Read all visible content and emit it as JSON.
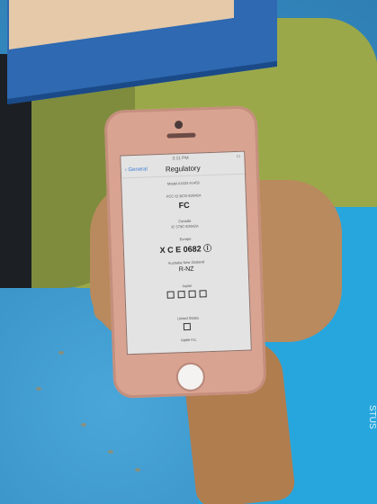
{
  "phone": {
    "status_left": "",
    "status_time": "3:11 PM",
    "back_label": "General",
    "screen_title": "Regulatory",
    "model_label": "Model A1533 A1453",
    "fcc_caption": "FCC ID BCG-E2642A",
    "fcc_mark": "FC",
    "canada_caption": "Canada",
    "canada_id": "IC 579C-E2642A",
    "europe_caption": "Europe",
    "europe_mark": "X C E 0682 ⓘ",
    "anz_caption": "Australia New Zealand",
    "anz_mark": "R-NZ",
    "japan_caption": "Japan",
    "usa_caption": "United States",
    "bottom_caption": "Apple Inc."
  },
  "shirt": {
    "print": "STUS"
  }
}
